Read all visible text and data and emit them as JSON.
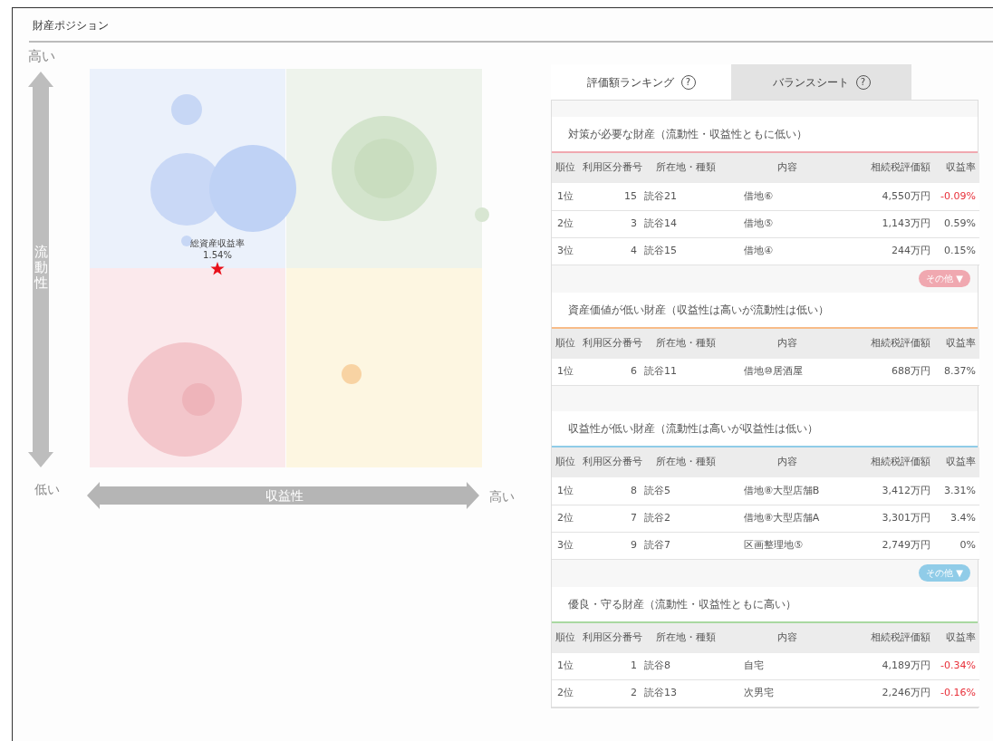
{
  "card": {
    "title": "財産ポジション"
  },
  "chart": {
    "y_high": "高い",
    "y_axis": "流動性",
    "y_low": "低い",
    "x_axis": "収益性",
    "x_high": "高い",
    "marker_label": "総資産収益率",
    "marker_value": "1.54%"
  },
  "tabs": [
    {
      "label": "評価額ランキング",
      "help": "?",
      "selected": true
    },
    {
      "label": "バランスシート",
      "help": "?",
      "selected": false
    }
  ],
  "sections": [
    {
      "title": "対策が必要な財産（流動性・収益性ともに低い）",
      "color": "#f0a8b0",
      "more": "その他 ▼",
      "columns": [
        "順位",
        "利用区分番号",
        "所在地・種類",
        "内容",
        "相続税評価額",
        "収益率"
      ],
      "rows": [
        {
          "rank": "1位",
          "number": "15",
          "location": "読谷21",
          "content": "借地⑥",
          "value": "4,550万円",
          "rate": "-0.09%",
          "negative": true
        },
        {
          "rank": "2位",
          "number": "3",
          "location": "読谷14",
          "content": "借地⑤",
          "value": "1,143万円",
          "rate": "0.59%",
          "negative": false
        },
        {
          "rank": "3位",
          "number": "4",
          "location": "読谷15",
          "content": "借地④",
          "value": "244万円",
          "rate": "0.15%",
          "negative": false
        }
      ]
    },
    {
      "title": "資産価値が低い財産（収益性は高いが流動性は低い）",
      "color": "#f8bc88",
      "columns": [
        "順位",
        "利用区分番号",
        "所在地・種類",
        "内容",
        "相続税評価額",
        "収益率"
      ],
      "rows": [
        {
          "rank": "1位",
          "number": "6",
          "location": "読谷11",
          "content": "借地⑩居酒屋",
          "value": "688万円",
          "rate": "8.37%",
          "negative": false
        }
      ]
    },
    {
      "title": "収益性が低い財産（流動性は高いが収益性は低い）",
      "color": "#90cce8",
      "more": "その他 ▼",
      "columns": [
        "順位",
        "利用区分番号",
        "所在地・種類",
        "内容",
        "相続税評価額",
        "収益率"
      ],
      "rows": [
        {
          "rank": "1位",
          "number": "8",
          "location": "読谷5",
          "content": "借地⑧大型店舗B",
          "value": "3,412万円",
          "rate": "3.31%",
          "negative": false
        },
        {
          "rank": "2位",
          "number": "7",
          "location": "読谷2",
          "content": "借地⑧大型店舗A",
          "value": "3,301万円",
          "rate": "3.4%",
          "negative": false
        },
        {
          "rank": "3位",
          "number": "9",
          "location": "読谷7",
          "content": "区画整理地⑤",
          "value": "2,749万円",
          "rate": "0%",
          "negative": false
        }
      ]
    },
    {
      "title": "優良・守る財産（流動性・収益性ともに高い）",
      "color": "#a8d8a0",
      "columns": [
        "順位",
        "利用区分番号",
        "所在地・種類",
        "内容",
        "相続税評価額",
        "収益率"
      ],
      "rows": [
        {
          "rank": "1位",
          "number": "1",
          "location": "読谷8",
          "content": "自宅",
          "value": "4,189万円",
          "rate": "-0.34%",
          "negative": true
        },
        {
          "rank": "2位",
          "number": "2",
          "location": "読谷13",
          "content": "次男宅",
          "value": "2,246万円",
          "rate": "-0.16%",
          "negative": true
        }
      ]
    }
  ]
}
